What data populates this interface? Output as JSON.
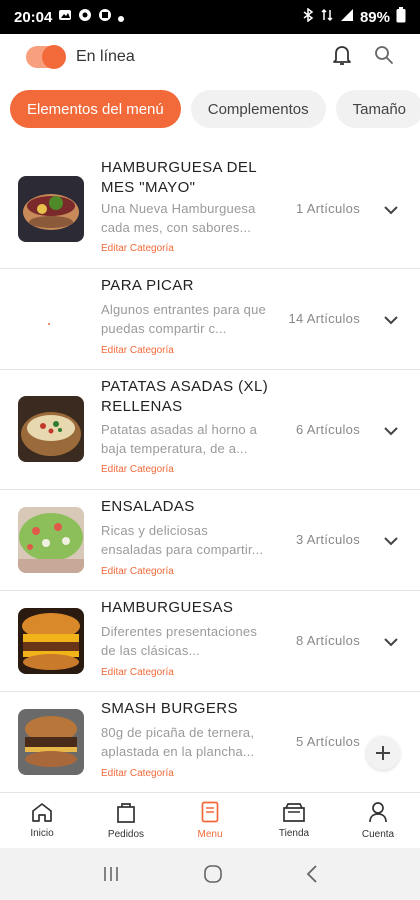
{
  "status_bar": {
    "time": "20:04",
    "battery": "89%"
  },
  "header": {
    "online_label": "En línea",
    "online": true
  },
  "tabs": [
    {
      "label": "Elementos del menú",
      "active": true
    },
    {
      "label": "Complementos",
      "active": false
    },
    {
      "label": "Tamaño",
      "active": false
    }
  ],
  "categories": [
    {
      "title": "HAMBURGUESA DEL MES \"MAYO\"",
      "description": "Una Nueva Hamburguesa cada mes, con sabores...",
      "edit_label": "Editar Categoría",
      "count": "1 Artículos",
      "image": "burger-of-month"
    },
    {
      "title": "PARA PICAR",
      "description": "Algunos entrantes para que puedas compartir c...",
      "edit_label": "Editar Categoría",
      "count": "14 Artículos",
      "image": "none"
    },
    {
      "title": "PATATAS ASADAS (XL) RELLENAS",
      "description": "Patatas asadas al horno a baja temperatura, de a...",
      "edit_label": "Editar Categoría",
      "count": "6 Artículos",
      "image": "baked-potato"
    },
    {
      "title": "ENSALADAS",
      "description": "Ricas y deliciosas ensaladas para compartir...",
      "edit_label": "Editar Categoría",
      "count": "3 Artículos",
      "image": "salad"
    },
    {
      "title": "HAMBURGUESAS",
      "description": "Diferentes presentaciones de las clásicas...",
      "edit_label": "Editar Categoría",
      "count": "8 Artículos",
      "image": "burger"
    },
    {
      "title": "SMASH BURGERS",
      "description": "80g de picaña de ternera, aplastada en la plancha...",
      "edit_label": "Editar Categoría",
      "count": "5 Artículos",
      "image": "smash-burger"
    }
  ],
  "bottom_nav": [
    {
      "label": "Inicio",
      "icon": "home-icon",
      "active": false
    },
    {
      "label": "Pedidos",
      "icon": "bag-icon",
      "active": false
    },
    {
      "label": "Menu",
      "icon": "menu-book-icon",
      "active": true
    },
    {
      "label": "Tienda",
      "icon": "store-icon",
      "active": false
    },
    {
      "label": "Cuenta",
      "icon": "user-icon",
      "active": false
    }
  ],
  "colors": {
    "accent": "#f26a3a",
    "accent_light": "#f8a07d",
    "muted_text": "#9a9a9a"
  }
}
